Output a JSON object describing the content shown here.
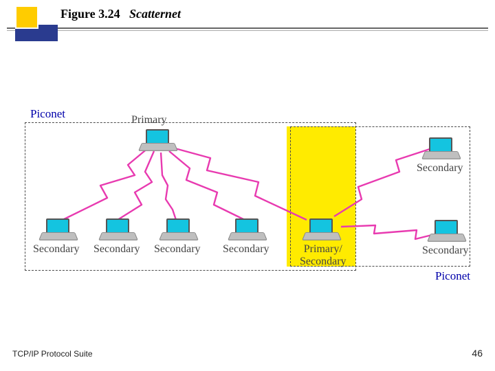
{
  "header": {
    "figure_number": "Figure 3.24",
    "figure_title": "Scatternet"
  },
  "footer": {
    "left": "TCP/IP Protocol Suite",
    "page": "46"
  },
  "diagram": {
    "piconet_left_label": "Piconet",
    "piconet_right_label": "Piconet",
    "nodes": {
      "primary": "Primary",
      "secondary": "Secondary",
      "bridge": "Primary/\nSecondary"
    }
  },
  "colors": {
    "accent_blue": "#2a3b8f",
    "accent_yellow": "#fc0",
    "highlight": "#ffeb00",
    "link": "#e83ab0"
  }
}
